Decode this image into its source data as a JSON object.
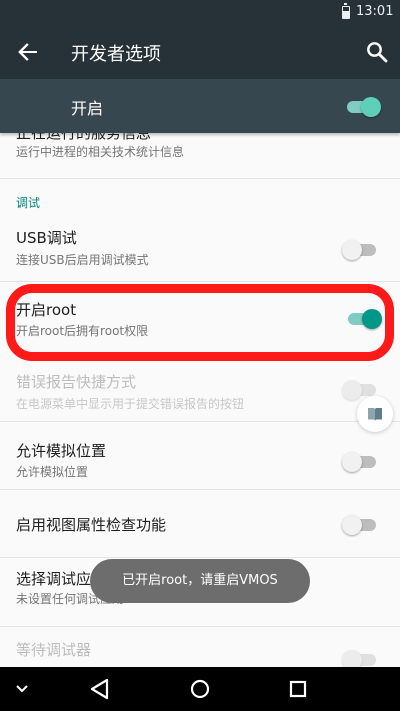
{
  "status_bar": {
    "time": "13:01",
    "battery_icon": "battery-icon"
  },
  "app_bar": {
    "title": "开发者选项",
    "back_icon": "arrow-back-icon",
    "search_icon": "search-icon"
  },
  "master_switch": {
    "label": "开启",
    "state": "on"
  },
  "preferences": {
    "running_services": {
      "title": "正在运行的服务信息",
      "summary": "运行中进程的相关技术统计信息"
    },
    "debug_section": {
      "header": "调试"
    },
    "usb_debugging": {
      "title": "USB调试",
      "summary": "连接USB后启用调试模式",
      "state": "off"
    },
    "enable_root": {
      "title": "开启root",
      "summary": "开启root后拥有root权限",
      "state": "on"
    },
    "bug_report": {
      "title": "错误报告快捷方式",
      "summary": "在电源菜单中显示用于提交错误报告的按钮",
      "state": "off",
      "enabled": false
    },
    "mock_location": {
      "title": "允许模拟位置",
      "summary": "允许模拟位置",
      "state": "off"
    },
    "view_attribute": {
      "title": "启用视图属性检查功能",
      "state": "off"
    },
    "debug_app": {
      "title": "选择调试应用",
      "summary": "未设置任何调试应用"
    },
    "wait_debugger": {
      "title": "等待调试器",
      "state": "off",
      "enabled": false
    }
  },
  "toast": {
    "text": "已开启root，请重启VMOS"
  },
  "floating_button": {
    "icon": "book-icon"
  },
  "nav_bar": {
    "recents_down": "chevron-down-icon",
    "back": "triangle-back-icon",
    "home": "circle-home-icon",
    "overview": "square-overview-icon"
  },
  "colors": {
    "accent": "#009688",
    "toolbar": "#263238",
    "highlight": "#ff1a1a"
  }
}
